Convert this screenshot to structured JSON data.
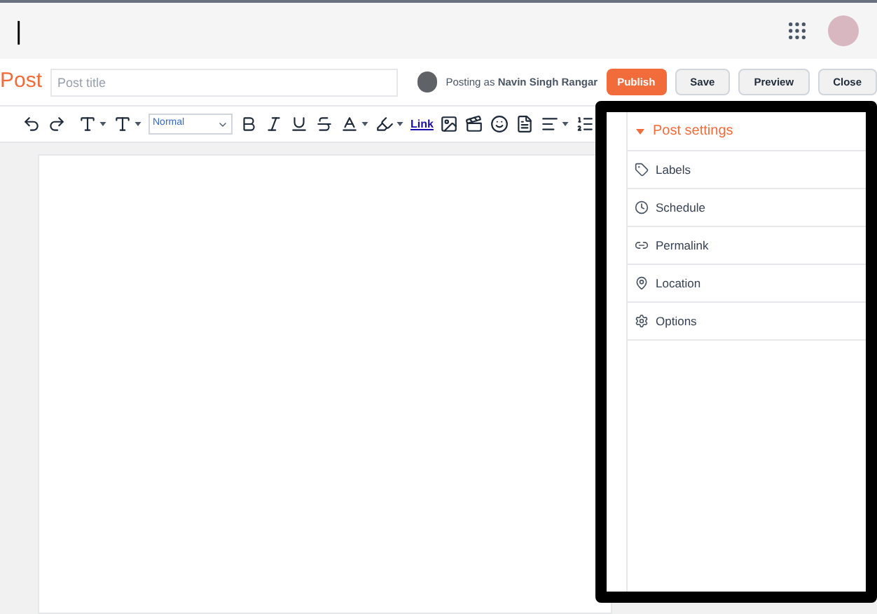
{
  "header": {
    "cursor": "|"
  },
  "post_bar": {
    "title": "Post",
    "title_field": {
      "placeholder": "Post title"
    },
    "posting_as": "Posting as **Navin Singh Rangar**",
    "buttons": [
      {
        "label": "Publish",
        "kind": "primary"
      },
      {
        "label": "Save",
        "kind": "plain"
      },
      {
        "label": "Preview",
        "kind": "plain"
      },
      {
        "label": "Close",
        "kind": "plain"
      }
    ]
  },
  "toolbar": {
    "format_select": "Normal",
    "link": "Link"
  },
  "post_settings": {
    "title": "Post settings",
    "expanded": true,
    "items": [
      {
        "label": "Labels"
      },
      {
        "label": "Schedule"
      },
      {
        "label": "Permalink"
      },
      {
        "label": "Location"
      },
      {
        "label": "Options"
      }
    ]
  }
}
